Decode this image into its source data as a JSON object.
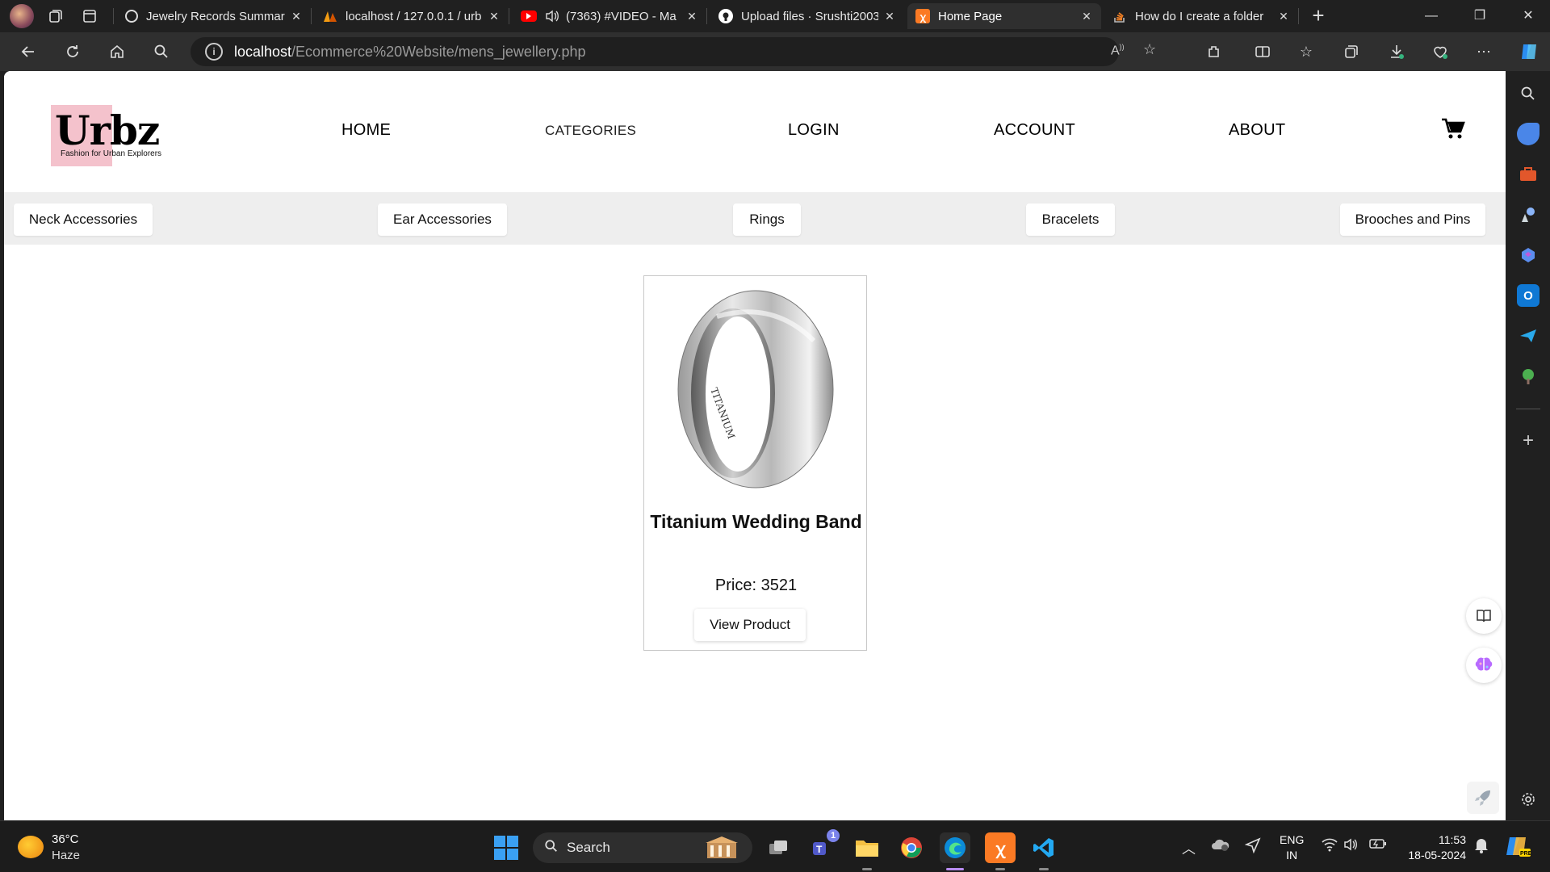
{
  "browser": {
    "tabs": [
      {
        "title": "Jewelry Records Summar",
        "favicon": "openai-icon",
        "active": false
      },
      {
        "title": "localhost / 127.0.0.1 / urb",
        "favicon": "phpmyadmin-icon",
        "active": false
      },
      {
        "title": "(7363) #VIDEO - Ma",
        "favicon": "youtube-icon",
        "active": false
      },
      {
        "title": "Upload files · Srushti2003",
        "favicon": "github-icon",
        "active": false
      },
      {
        "title": "Home Page",
        "favicon": "xampp-icon",
        "active": true
      },
      {
        "title": "How do I create a folder",
        "favicon": "stackoverflow-icon",
        "active": false
      }
    ],
    "address": {
      "host": "localhost",
      "path": "/Ecommerce%20Website/mens_jewellery.php"
    }
  },
  "site": {
    "logo": {
      "word": "Urbz",
      "tagline": "Fashion for Urban Explorers",
      "accent": "#f4c2cc"
    },
    "menu": {
      "home": "HOME",
      "categories": "CATEGORIES",
      "login": "LOGIN",
      "account": "ACCOUNT",
      "about": "ABOUT"
    },
    "categories": [
      "Neck Accessories",
      "Ear Accessories",
      "Rings",
      "Bracelets",
      "Brooches and Pins"
    ],
    "product": {
      "title": "Titanium Wedding Band",
      "price": "Price: 3521",
      "button": "View Product",
      "engraving": "TITANIUM"
    }
  },
  "taskbar": {
    "weather": {
      "temp": "36°C",
      "desc": "Haze"
    },
    "search": "Search",
    "teams_badge": "1",
    "language": {
      "line1": "ENG",
      "line2": "IN"
    },
    "clock": {
      "time": "11:53",
      "date": "18-05-2024"
    }
  }
}
